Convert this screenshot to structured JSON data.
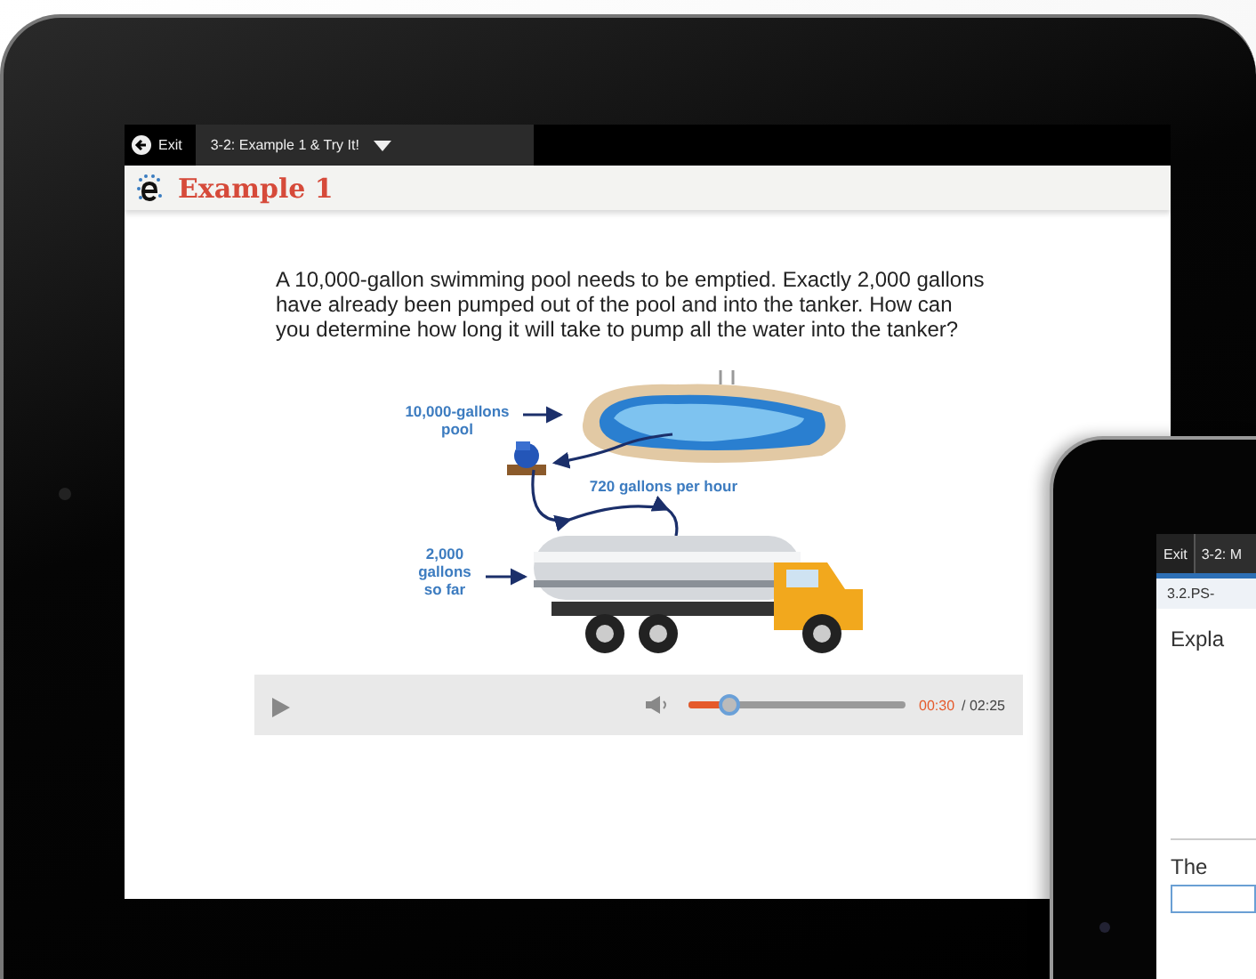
{
  "main_tablet": {
    "exit": "Exit",
    "lesson_tab": "3-2: Example 1 & Try It!",
    "title": "Example 1",
    "question": "A 10,000-gallon swimming pool needs to be emptied. Exactly 2,000 gallons have already been pumped out of the pool and into the tanker. How can you determine how long it will take to pump all the water into the tanker?",
    "figure": {
      "pool_label": "10,000-gallons pool",
      "rate_label": "720 gallons per hour",
      "tanker_label": "2,000 gallons so far"
    },
    "player": {
      "level": 0.19,
      "current_time": "00:30",
      "total_time": "/ 02:25"
    }
  },
  "second_tablet": {
    "exit": "Exit",
    "lesson_tab": "3-2: M",
    "item_code": "3.2.PS-",
    "prompt": "Expla",
    "answer_label": "The"
  }
}
